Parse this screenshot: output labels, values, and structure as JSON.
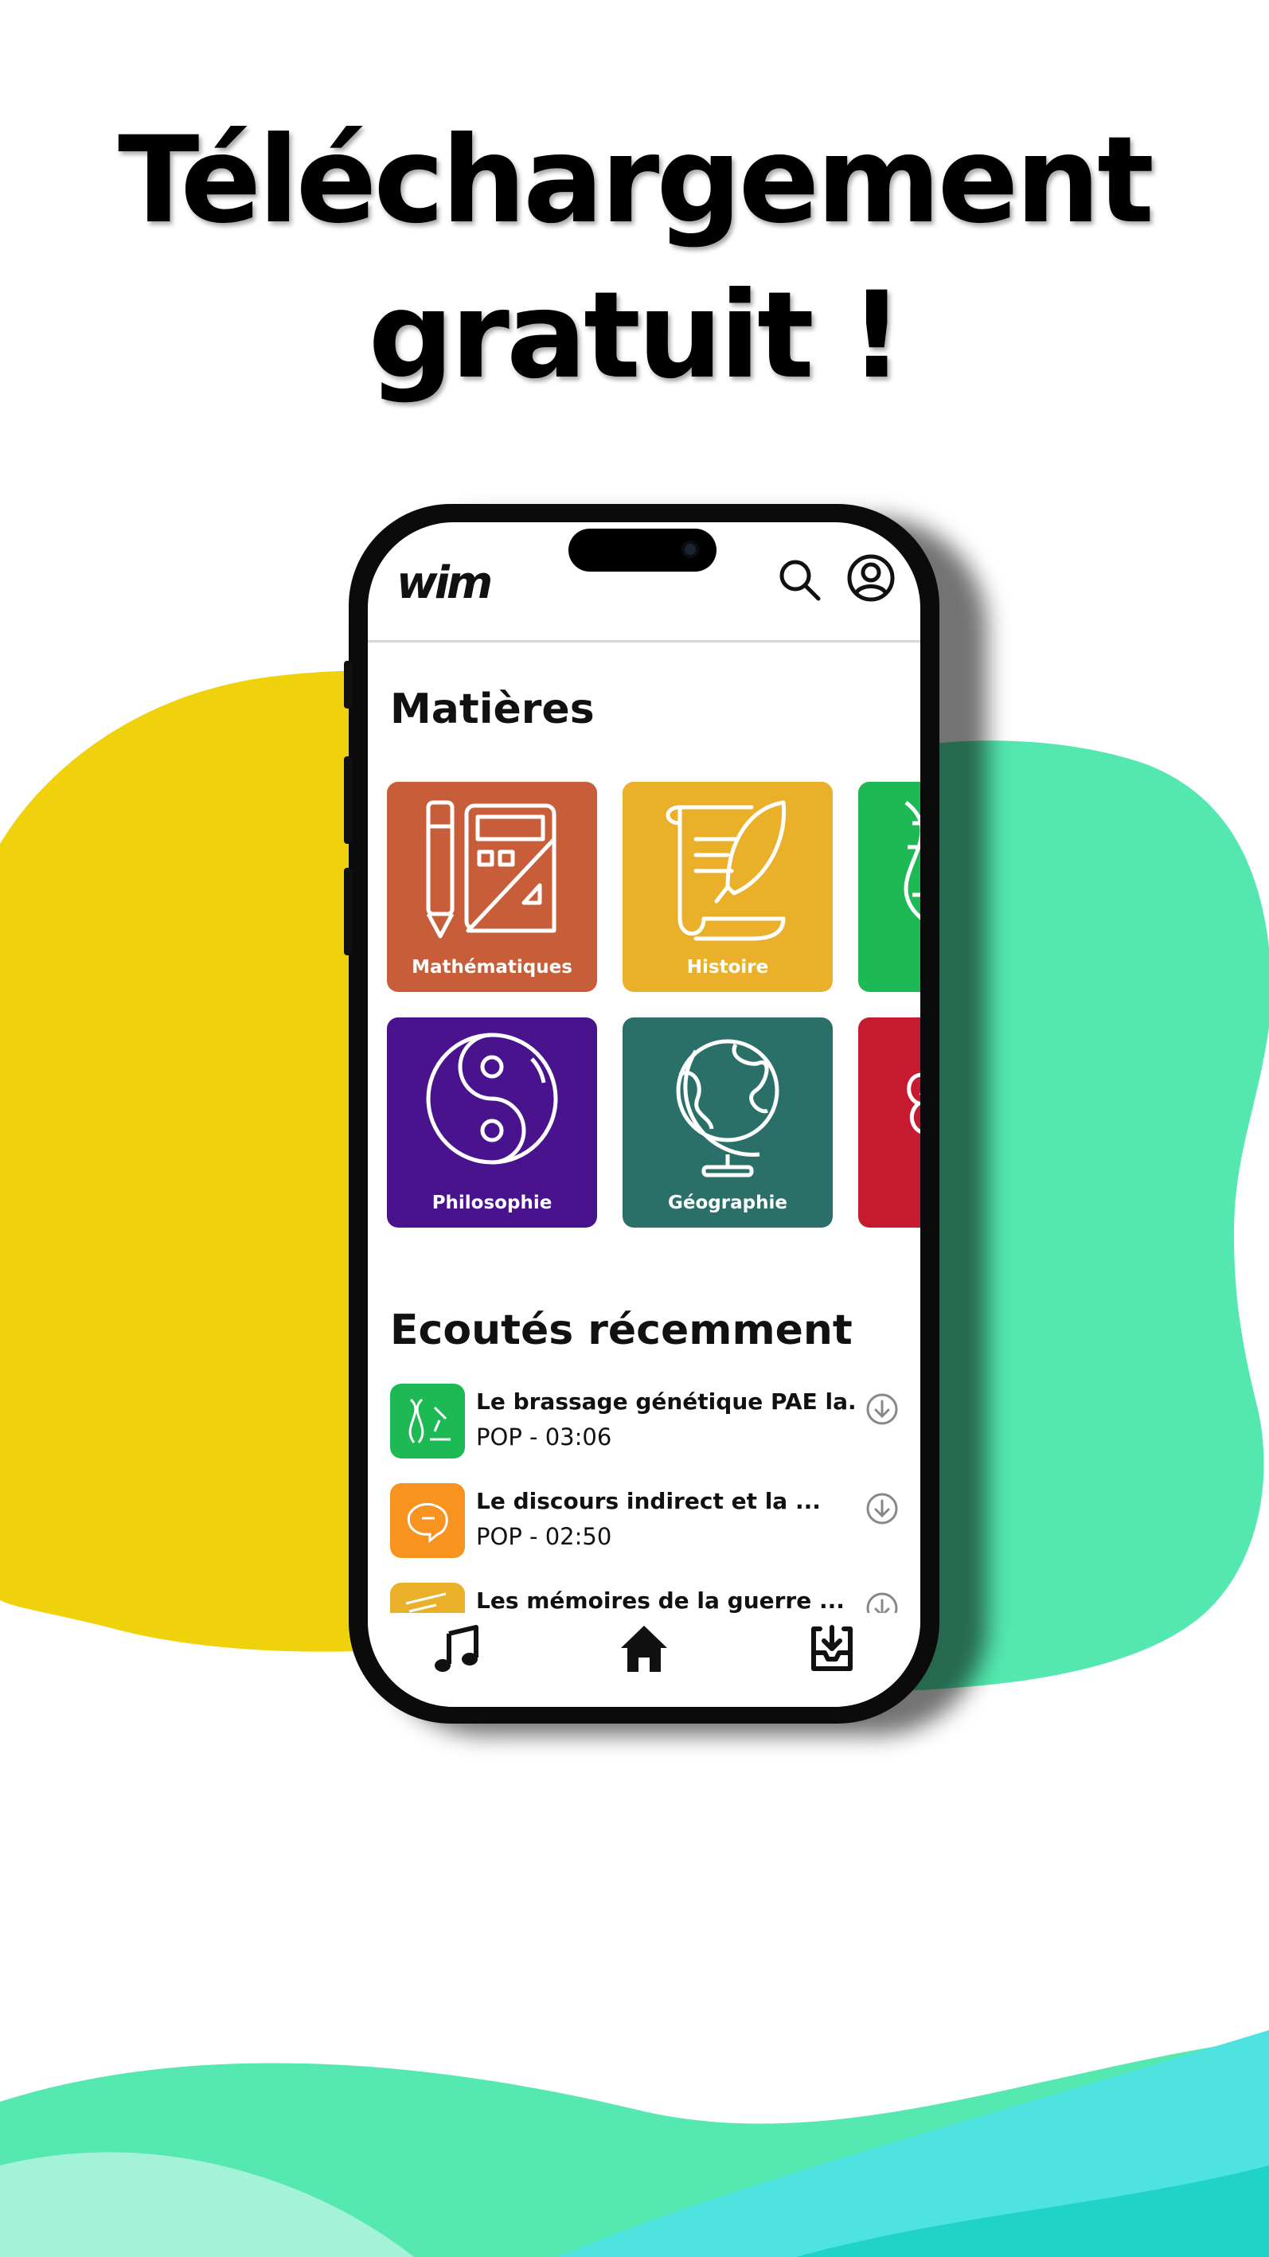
{
  "headline": {
    "line1": "Téléchargement",
    "line2": "gratuit !"
  },
  "app": {
    "logo": "wim"
  },
  "colors": {
    "yellow_blob": "#efd20b",
    "green_blob": "#54e8b0",
    "wave_green": "#55e8b0",
    "wave_cyan": "#4ee3e0"
  },
  "subjects": {
    "title": "Matières",
    "items": [
      {
        "label": "Mathématiques",
        "color": "#c85d3a",
        "icon": "math-tools-icon"
      },
      {
        "label": "Histoire",
        "color": "#eab02a",
        "icon": "scroll-quill-icon"
      },
      {
        "label": "",
        "color": "#1db954",
        "icon": "dna-icon"
      },
      {
        "label": "Philosophie",
        "color": "#4a138e",
        "icon": "yin-yang-icon"
      },
      {
        "label": "Géographie",
        "color": "#2a6f68",
        "icon": "globe-icon"
      },
      {
        "label": "",
        "color": "#c51a2f",
        "icon": "brain-icon"
      }
    ]
  },
  "recent": {
    "title": "Ecoutés récemment",
    "items": [
      {
        "title": "Le brassage génétique PAE la...",
        "meta": "POP - 03:06",
        "color": "#1db954",
        "icon": "dna-microscope-icon"
      },
      {
        "title": "Le discours indirect et la ...",
        "meta": "POP - 02:50",
        "color": "#f7931e",
        "icon": "speech-icon"
      },
      {
        "title": "Les mémoires de la guerre ...",
        "meta": "",
        "color": "#eab02a",
        "icon": "scroll-icon"
      }
    ]
  },
  "nav": {
    "items": [
      "music-icon",
      "home-icon",
      "download-inbox-icon"
    ]
  }
}
